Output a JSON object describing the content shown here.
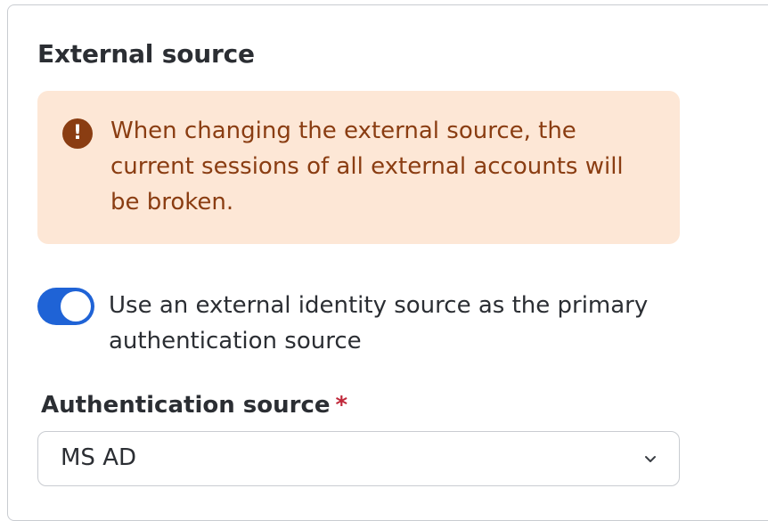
{
  "section": {
    "title": "External source"
  },
  "warning": {
    "icon": "exclamation-circle-icon",
    "text": "When changing the external source, the current sessions of all external accounts will be broken.",
    "color": "#8a3d12",
    "background": "#fde7d6"
  },
  "toggle": {
    "checked": true,
    "label": "Use an external identity source as the primary authentication source",
    "color": "#1f63d6"
  },
  "auth_source": {
    "label": "Authentication source",
    "required_mark": "*",
    "selected_value": "MS AD",
    "icon": "chevron-down-icon"
  }
}
